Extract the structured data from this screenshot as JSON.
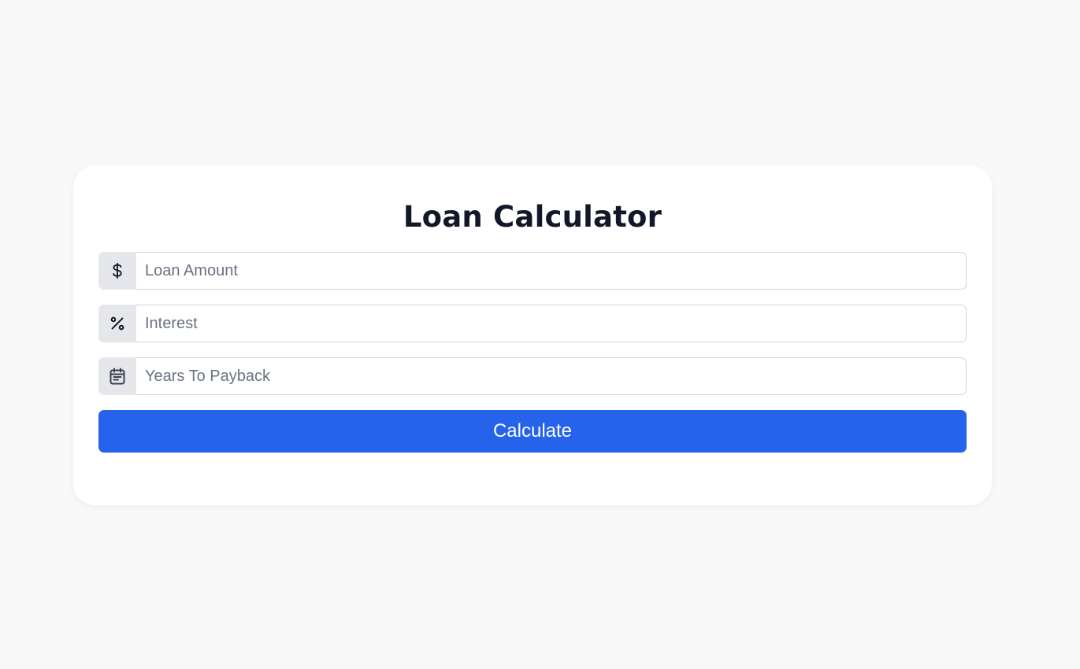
{
  "form": {
    "title": "Loan Calculator",
    "fields": [
      {
        "icon": "dollar-icon",
        "placeholder": "Loan Amount",
        "value": ""
      },
      {
        "icon": "percent-icon",
        "placeholder": "Interest",
        "value": ""
      },
      {
        "icon": "calendar-icon",
        "placeholder": "Years To Payback",
        "value": ""
      }
    ],
    "submit_label": "Calculate"
  },
  "colors": {
    "background": "#f9f9f9",
    "card": "#ffffff",
    "title": "#111827",
    "addon": "#e5e7eb",
    "button": "#2563eb",
    "button_text": "#ffffff"
  }
}
